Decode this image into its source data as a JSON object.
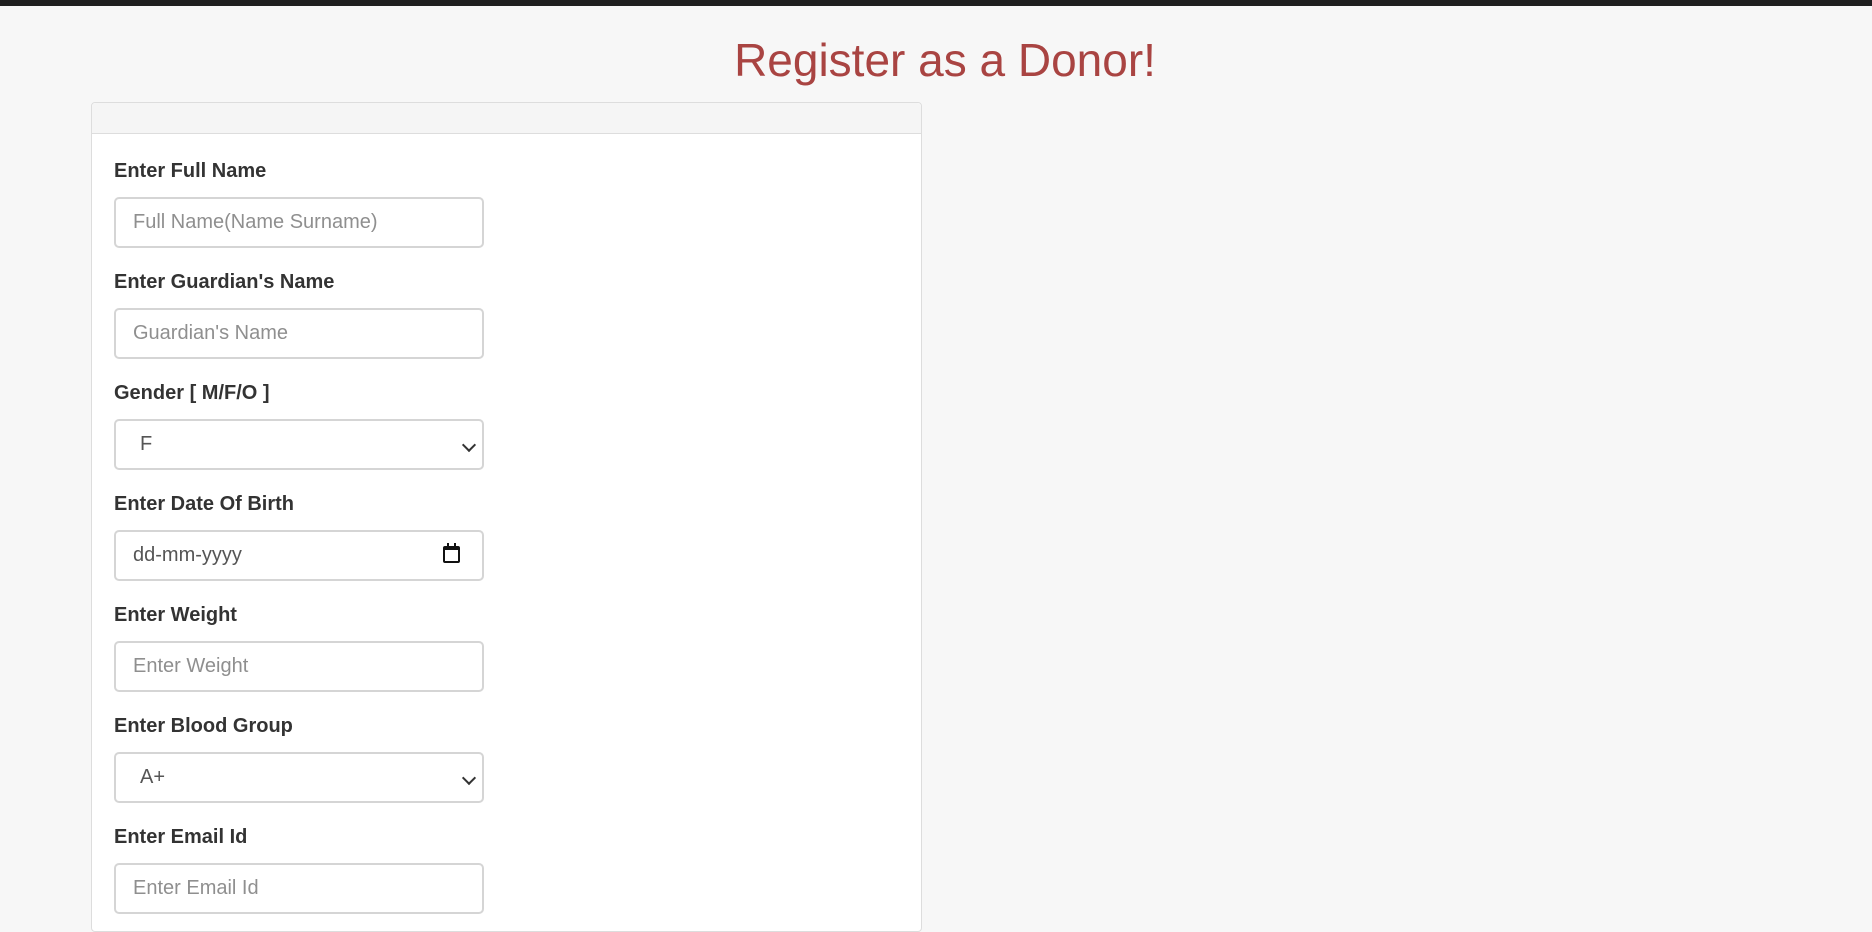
{
  "page": {
    "title": "Register as a Donor!",
    "title_color": "#a94442",
    "background_color": "#f7f7f7"
  },
  "form": {
    "full_name": {
      "label": "Enter Full Name",
      "placeholder": "Full Name(Name Surname)",
      "value": ""
    },
    "guardian_name": {
      "label": "Enter Guardian's Name",
      "placeholder": "Guardian's Name",
      "value": ""
    },
    "gender": {
      "label": "Gender [ M/F/O ]",
      "selected": "F",
      "icon": "chevron-down-icon"
    },
    "dob": {
      "label": "Enter Date Of Birth",
      "placeholder": "dd-mm-yyyy",
      "icon": "calendar-icon"
    },
    "weight": {
      "label": "Enter Weight",
      "placeholder": "Enter Weight",
      "value": ""
    },
    "blood_group": {
      "label": "Enter Blood Group",
      "selected": "A+",
      "icon": "chevron-down-icon"
    },
    "email": {
      "label": "Enter Email Id",
      "placeholder": "Enter Email Id",
      "value": ""
    }
  }
}
